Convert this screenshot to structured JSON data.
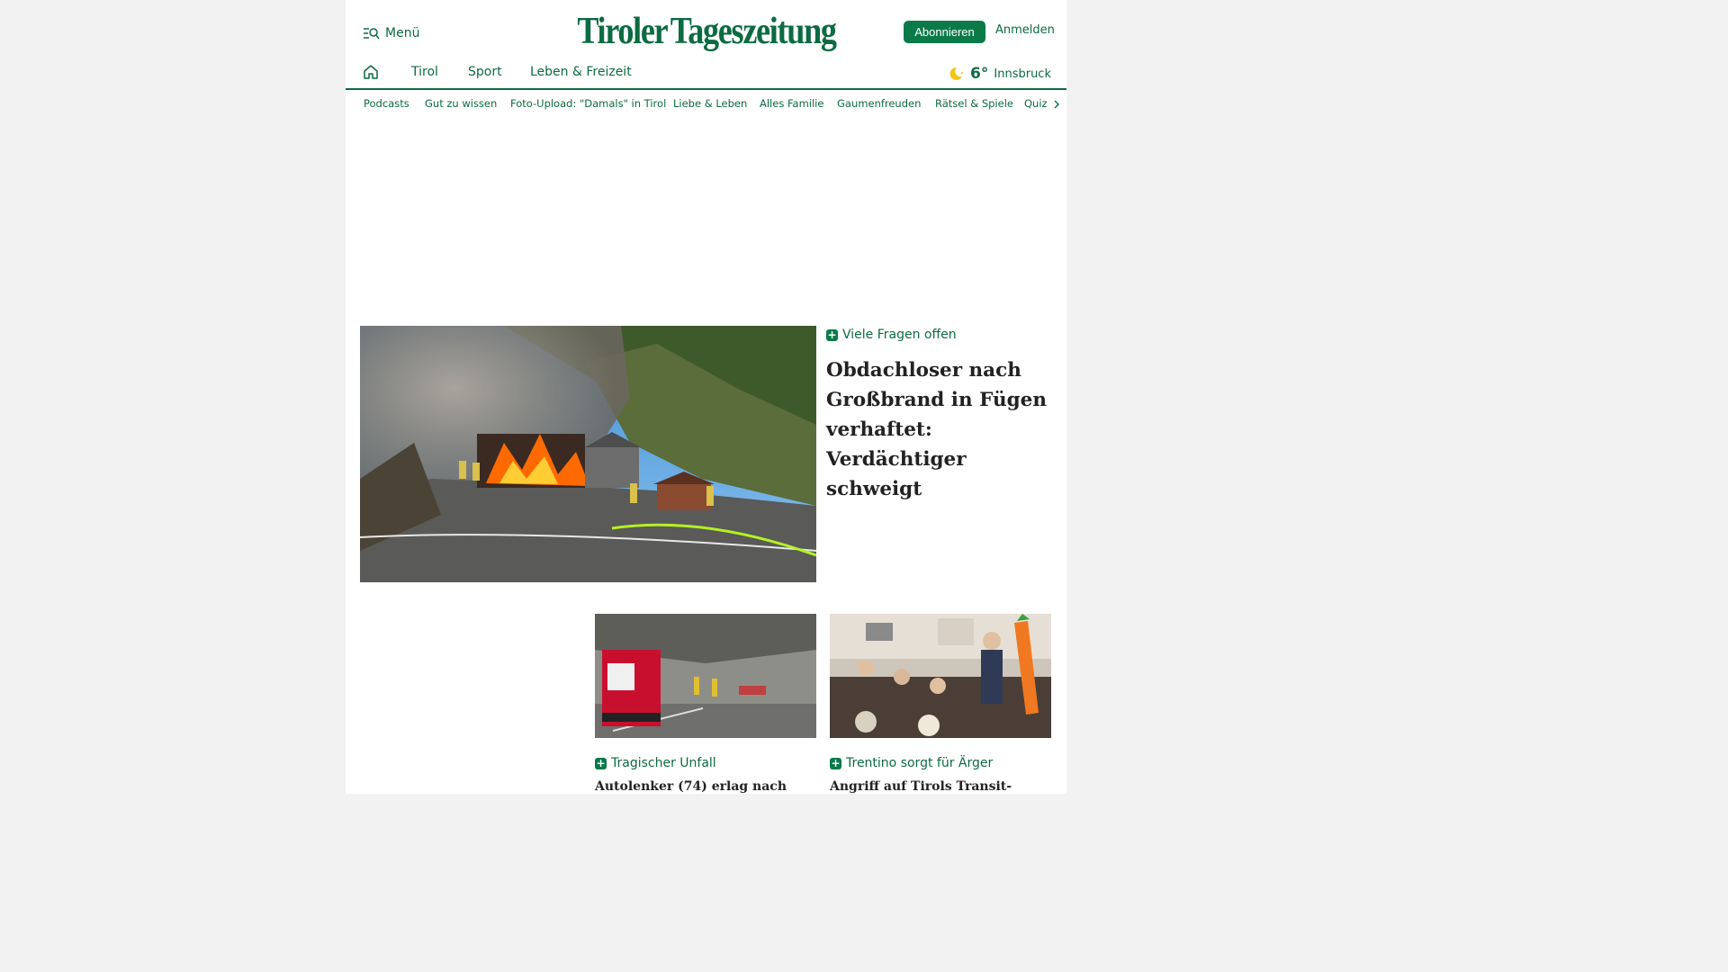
{
  "header": {
    "menu_label": "Menü",
    "logo_left": "Tiroler",
    "logo_right": "Tageszeitung",
    "subscribe_label": "Abonnieren",
    "login_label": "Anmelden"
  },
  "main_nav": {
    "items": [
      {
        "label": "Tirol"
      },
      {
        "label": "Sport"
      },
      {
        "label": "Leben & Freizeit"
      }
    ],
    "weather": {
      "temperature": "6°",
      "city": "Innsbruck",
      "icon": "moon-sun-icon"
    }
  },
  "sub_nav": {
    "items": [
      {
        "label": "Podcasts"
      },
      {
        "label": "Gut zu wissen"
      },
      {
        "label": "Foto-Upload: \"Damals\" in Tirol"
      },
      {
        "label": "Liebe & Leben"
      },
      {
        "label": "Alles Familie"
      },
      {
        "label": "Gaumenfreuden"
      },
      {
        "label": "Rätsel & Spiele"
      },
      {
        "label": "Quiz"
      }
    ]
  },
  "lead_article": {
    "kicker": "Viele Fragen offen",
    "title": "Obdachloser nach Großbrand in Fügen verhaftet: Verdächtiger schweigt"
  },
  "cards": [
    {
      "kicker": "Tragischer Unfall",
      "title": "Autolenker (74) erlag nach"
    },
    {
      "kicker": "Trentino sorgt für Ärger",
      "title": "Angriff auf Tirols Transit-"
    }
  ],
  "colors": {
    "brand_green": "#0b6b41",
    "button_green": "#0b7a49"
  }
}
